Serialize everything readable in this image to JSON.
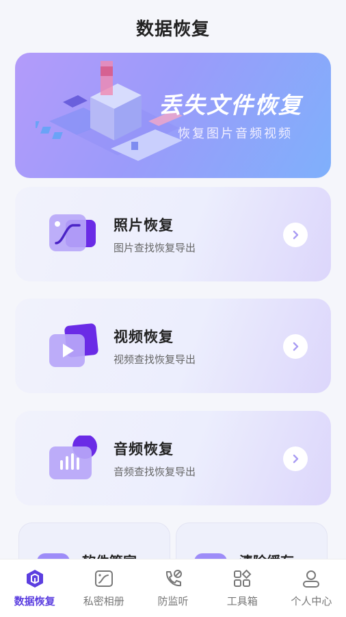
{
  "header": {
    "title": "数据恢复"
  },
  "banner": {
    "title": "丢失文件恢复",
    "subtitle": "恢复图片音频视频"
  },
  "cards": [
    {
      "title": "照片恢复",
      "subtitle": "图片查找恢复导出",
      "icon": "photo-icon"
    },
    {
      "title": "视频恢复",
      "subtitle": "视频查找恢复导出",
      "icon": "video-icon"
    },
    {
      "title": "音频恢复",
      "subtitle": "音频查找恢复导出",
      "icon": "audio-icon"
    }
  ],
  "mini_cards": [
    {
      "title": "软件管家"
    },
    {
      "title": "清除缓存"
    }
  ],
  "tabs": [
    {
      "label": "数据恢复",
      "icon": "data-recovery-icon",
      "active": true
    },
    {
      "label": "私密相册",
      "icon": "album-icon"
    },
    {
      "label": "防监听",
      "icon": "phone-shield-icon"
    },
    {
      "label": "工具箱",
      "icon": "toolbox-icon"
    },
    {
      "label": "个人中心",
      "icon": "user-icon"
    }
  ],
  "colors": {
    "accent": "#5c3fe0",
    "banner_start": "#b39bfa",
    "banner_end": "#7fb0fb"
  }
}
